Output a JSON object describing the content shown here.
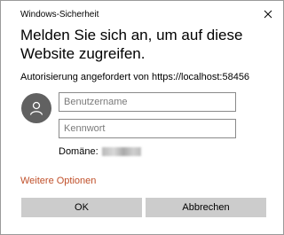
{
  "window": {
    "title": "Windows-Sicherheit",
    "close_icon": "close-icon"
  },
  "dialog": {
    "heading": "Melden Sie sich an, um auf diese Website zugreifen.",
    "authorization_text": "Autorisierung angefordert von https://localhost:58456",
    "avatar_icon": "user-icon",
    "username": {
      "placeholder": "Benutzername",
      "value": ""
    },
    "password": {
      "placeholder": "Kennwort",
      "value": ""
    },
    "domain_label": "Domäne:",
    "more_options": "Weitere Optionen",
    "ok_label": "OK",
    "cancel_label": "Abbrechen"
  },
  "colors": {
    "link": "#c0502a",
    "button_bg": "#cccccc",
    "avatar_bg": "#616161"
  }
}
